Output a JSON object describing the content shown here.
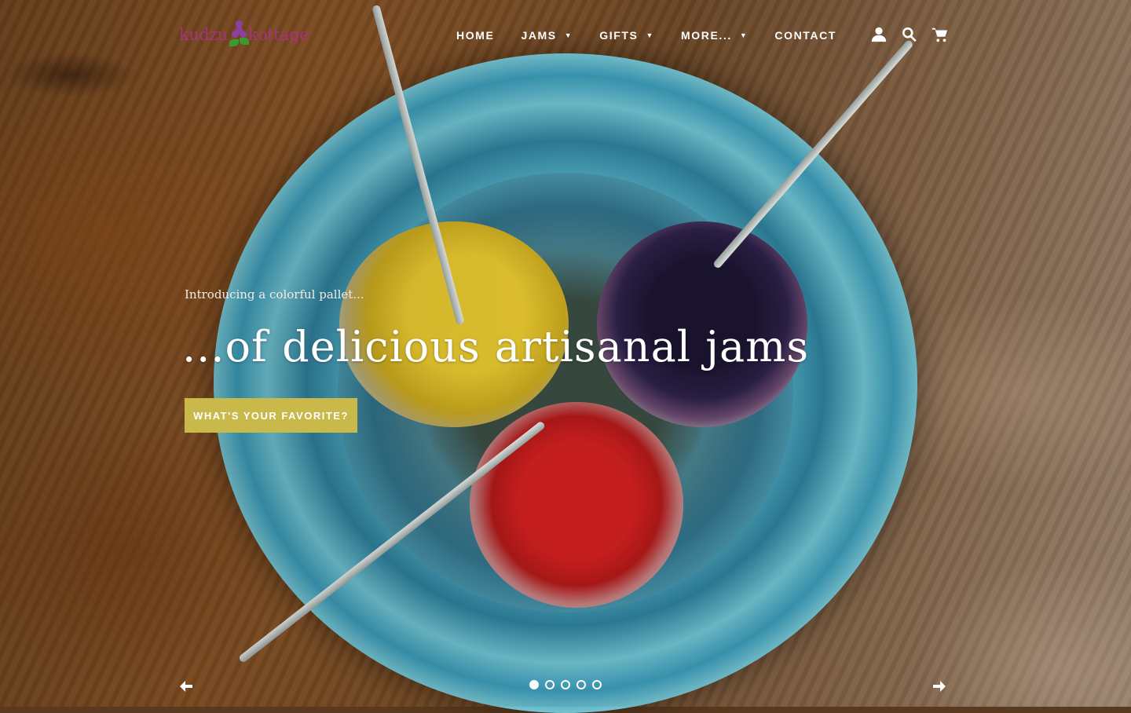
{
  "brand": {
    "logo_part1": "kudzu",
    "logo_part2": "kottage",
    "logo_color": "#a8327e"
  },
  "nav": {
    "items": [
      {
        "label": "HOME",
        "has_dropdown": false
      },
      {
        "label": "JAMS",
        "has_dropdown": true
      },
      {
        "label": "GIFTS",
        "has_dropdown": true
      },
      {
        "label": "MORE...",
        "has_dropdown": true
      },
      {
        "label": "CONTACT",
        "has_dropdown": false
      }
    ],
    "icons": [
      "account-icon",
      "search-icon",
      "cart-icon"
    ]
  },
  "hero": {
    "subtitle": "Introducing a colorful pallet...",
    "title": "...of delicious artisanal jams",
    "cta_label": "WHAT'S YOUR FAVORITE?",
    "cta_color": "#c9b84a"
  },
  "slideshow": {
    "slide_count": 5,
    "active_index": 0,
    "prev_icon": "arrow-left-icon",
    "next_icon": "arrow-right-icon"
  }
}
